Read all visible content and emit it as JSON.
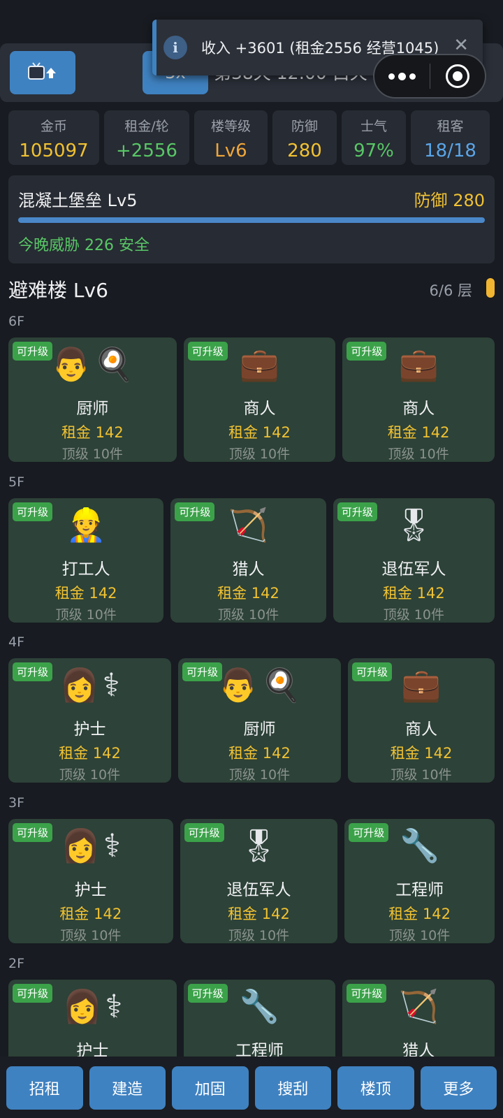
{
  "header": {
    "speed_label": "3x",
    "day_text": "第38天 12:00 白天"
  },
  "toast": {
    "icon": "i",
    "text": "收入 +3601 (租金2556 经营1045)",
    "close": "✕"
  },
  "stats": [
    {
      "label": "金币",
      "value": "105097",
      "color": "#f1c232"
    },
    {
      "label": "租金/轮",
      "value": "+2556",
      "color": "#58c766"
    },
    {
      "label": "楼等级",
      "value": "Lv6",
      "color": "#f0a73a"
    },
    {
      "label": "防御",
      "value": "280",
      "color": "#f1c232"
    },
    {
      "label": "士气",
      "value": "97%",
      "color": "#58c766"
    },
    {
      "label": "租客",
      "value": "18/18",
      "color": "#5aa5e8"
    }
  ],
  "defense": {
    "name": "混凝土堡垒 Lv5",
    "value": "防御 280",
    "threat": "今晚威胁 226 安全",
    "bar_fraction": 1.0
  },
  "building": {
    "title": "避难楼 Lv6",
    "floors": "6/6 层"
  },
  "rows": [
    {
      "floor": "6F",
      "cards": [
        {
          "badge": "可升级",
          "icons": [
            "👨",
            "🍳"
          ],
          "job": "厨师",
          "rent": "租金 142",
          "stock": "顶级 10件"
        },
        {
          "badge": "可升级",
          "icons": [
            "💼"
          ],
          "job": "商人",
          "rent": "租金 142",
          "stock": "顶级 10件"
        },
        {
          "badge": "可升级",
          "icons": [
            "💼"
          ],
          "job": "商人",
          "rent": "租金 142",
          "stock": "顶级 10件"
        }
      ]
    },
    {
      "floor": "5F",
      "cards": [
        {
          "badge": "可升级",
          "icons": [
            "👷"
          ],
          "job": "打工人",
          "rent": "租金 142",
          "stock": "顶级 10件"
        },
        {
          "badge": "可升级",
          "icons": [
            "🏹"
          ],
          "job": "猎人",
          "rent": "租金 142",
          "stock": "顶级 10件"
        },
        {
          "badge": "可升级",
          "icons": [
            "🎖"
          ],
          "job": "退伍军人",
          "rent": "租金 142",
          "stock": "顶级 10件"
        }
      ]
    },
    {
      "floor": "4F",
      "cards": [
        {
          "badge": "可升级",
          "icons": [
            "👩",
            "⚕"
          ],
          "job": "护士",
          "rent": "租金 142",
          "stock": "顶级 10件"
        },
        {
          "badge": "可升级",
          "icons": [
            "👨",
            "🍳"
          ],
          "job": "厨师",
          "rent": "租金 142",
          "stock": "顶级 10件"
        },
        {
          "badge": "可升级",
          "icons": [
            "💼"
          ],
          "job": "商人",
          "rent": "租金 142",
          "stock": "顶级 10件"
        }
      ]
    },
    {
      "floor": "3F",
      "cards": [
        {
          "badge": "可升级",
          "icons": [
            "👩",
            "⚕"
          ],
          "job": "护士",
          "rent": "租金 142",
          "stock": "顶级 10件"
        },
        {
          "badge": "可升级",
          "icons": [
            "🎖"
          ],
          "job": "退伍军人",
          "rent": "租金 142",
          "stock": "顶级 10件"
        },
        {
          "badge": "可升级",
          "icons": [
            "🔧"
          ],
          "job": "工程师",
          "rent": "租金 142",
          "stock": "顶级 10件"
        }
      ]
    },
    {
      "floor": "2F",
      "cards": [
        {
          "badge": "可升级",
          "icons": [
            "👩",
            "⚕"
          ],
          "job": "护士",
          "rent": "",
          "stock": ""
        },
        {
          "badge": "可升级",
          "icons": [
            "🔧"
          ],
          "job": "工程师",
          "rent": "",
          "stock": ""
        },
        {
          "badge": "可升级",
          "icons": [
            "🏹"
          ],
          "job": "猎人",
          "rent": "",
          "stock": ""
        }
      ]
    }
  ],
  "nav": [
    "招租",
    "建造",
    "加固",
    "搜刮",
    "楼顶",
    "更多"
  ]
}
